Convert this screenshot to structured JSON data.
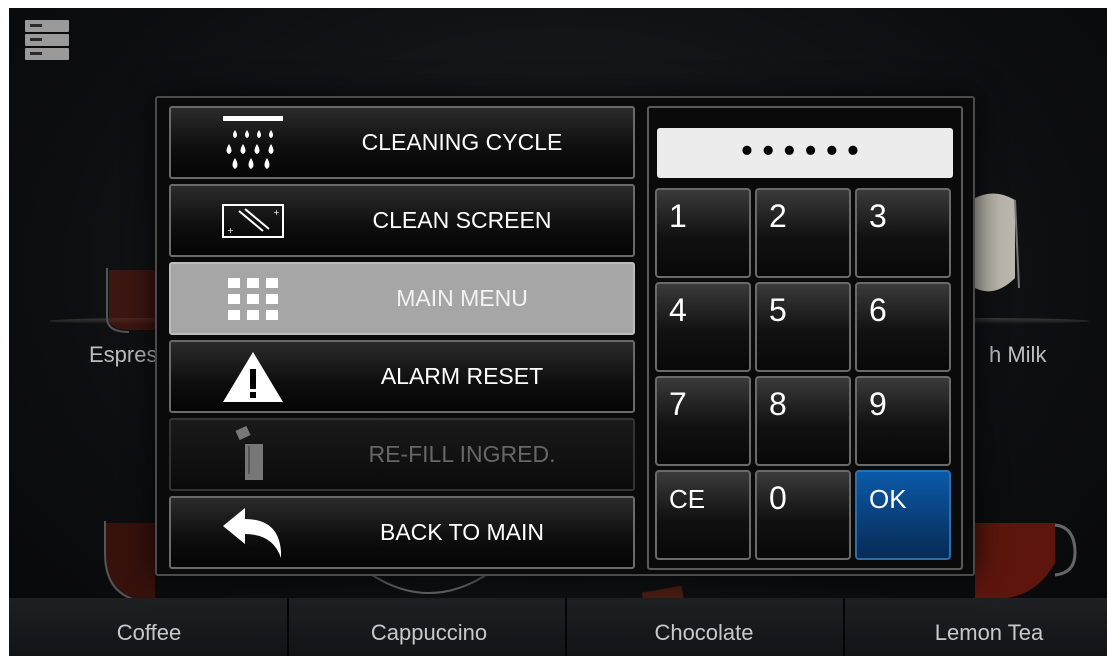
{
  "background_tiles": {
    "row1_labels": [
      "Espresso",
      "h Milk"
    ],
    "bottom_labels": [
      "Coffee",
      "Cappuccino",
      "Chocolate",
      "Lemon Tea"
    ]
  },
  "menu": {
    "items": [
      {
        "label": "CLEANING CYCLE",
        "icon": "shower-drops-icon",
        "state": "normal"
      },
      {
        "label": "CLEAN SCREEN",
        "icon": "wipe-screen-icon",
        "state": "normal"
      },
      {
        "label": "MAIN MENU",
        "icon": "grid-icon",
        "state": "active"
      },
      {
        "label": "ALARM RESET",
        "icon": "warning-icon",
        "state": "normal"
      },
      {
        "label": "RE-FILL INGRED.",
        "icon": "refill-icon",
        "state": "disabled"
      },
      {
        "label": "BACK TO MAIN",
        "icon": "back-arrow-icon",
        "state": "normal"
      }
    ]
  },
  "keypad": {
    "display": "••••••",
    "keys": [
      "1",
      "2",
      "3",
      "4",
      "5",
      "6",
      "7",
      "8",
      "9",
      "CE",
      "0",
      "OK"
    ],
    "ok_color": "#0b5aa8"
  }
}
